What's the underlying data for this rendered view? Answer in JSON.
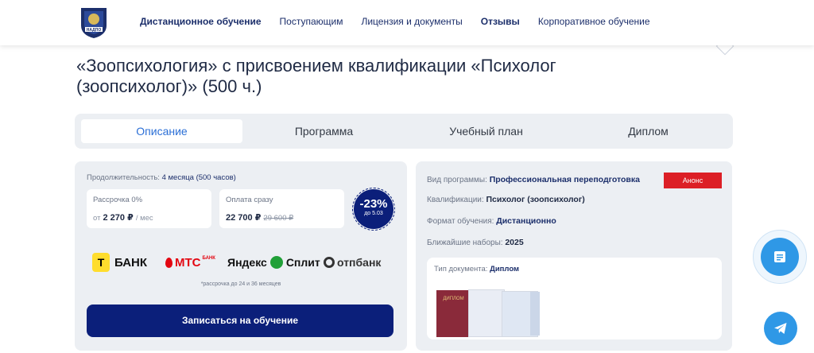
{
  "nav": {
    "items": [
      {
        "label": "Дистанционное обучение",
        "bold": true
      },
      {
        "label": "Поступающим",
        "bold": false
      },
      {
        "label": "Лицензия и документы",
        "bold": false
      },
      {
        "label": "Отзывы",
        "bold": true
      },
      {
        "label": "Корпоративное обучение",
        "bold": false
      }
    ],
    "logo_text": "НАДПО"
  },
  "page_title": "«Зоопсихология» с присвоением квалификации «Психолог (зоопсихолог)» (500 ч.)",
  "tabs": [
    {
      "label": "Описание",
      "active": true
    },
    {
      "label": "Программа",
      "active": false
    },
    {
      "label": "Учебный план",
      "active": false
    },
    {
      "label": "Диплом",
      "active": false
    }
  ],
  "pricing": {
    "duration_label": "Продолжительность:",
    "duration_value": "4 месяца (500 часов)",
    "installment_label": "Рассрочка 0%",
    "installment_prefix": "от",
    "installment_value": "2 270 ₽",
    "installment_suffix": "/ мес",
    "full_label": "Оплата сразу",
    "full_value": "22 700 ₽",
    "full_old": "29 600 ₽",
    "discount": "-23%",
    "discount_until": "до 5.03",
    "footnote": "*рассрочка до 24 и 36 месяцев",
    "cta": "Записаться на обучение"
  },
  "banks": {
    "tbank_mark": "Т",
    "tbank": "БАНК",
    "mts": "МТС",
    "mts_sub": "БАНК",
    "yandex": "Яндекс",
    "split": "Сплит",
    "otp": "отпбанк"
  },
  "details": {
    "type_label": "Вид программы:",
    "type_value": "Профессиональная переподготовка",
    "badge": "Анонс",
    "qual_label": "Квалификации:",
    "qual_value": "Психолог (зоопсихолог)",
    "format_label": "Формат обучения:",
    "format_value": "Дистанционно",
    "sets_label": "Ближайшие наборы:",
    "sets_value": "2025",
    "doc_label": "Тип документа:",
    "doc_value": "Диплом",
    "diploma_word": "ДИПЛОМ"
  },
  "colors": {
    "primary": "#0b1f7a",
    "accent_blue": "#2b6fd6",
    "fab_blue": "#2f98e6",
    "anons_red": "#dc1f26"
  },
  "icons": [
    "logo-emblem",
    "chat-form-icon",
    "telegram-icon"
  ]
}
